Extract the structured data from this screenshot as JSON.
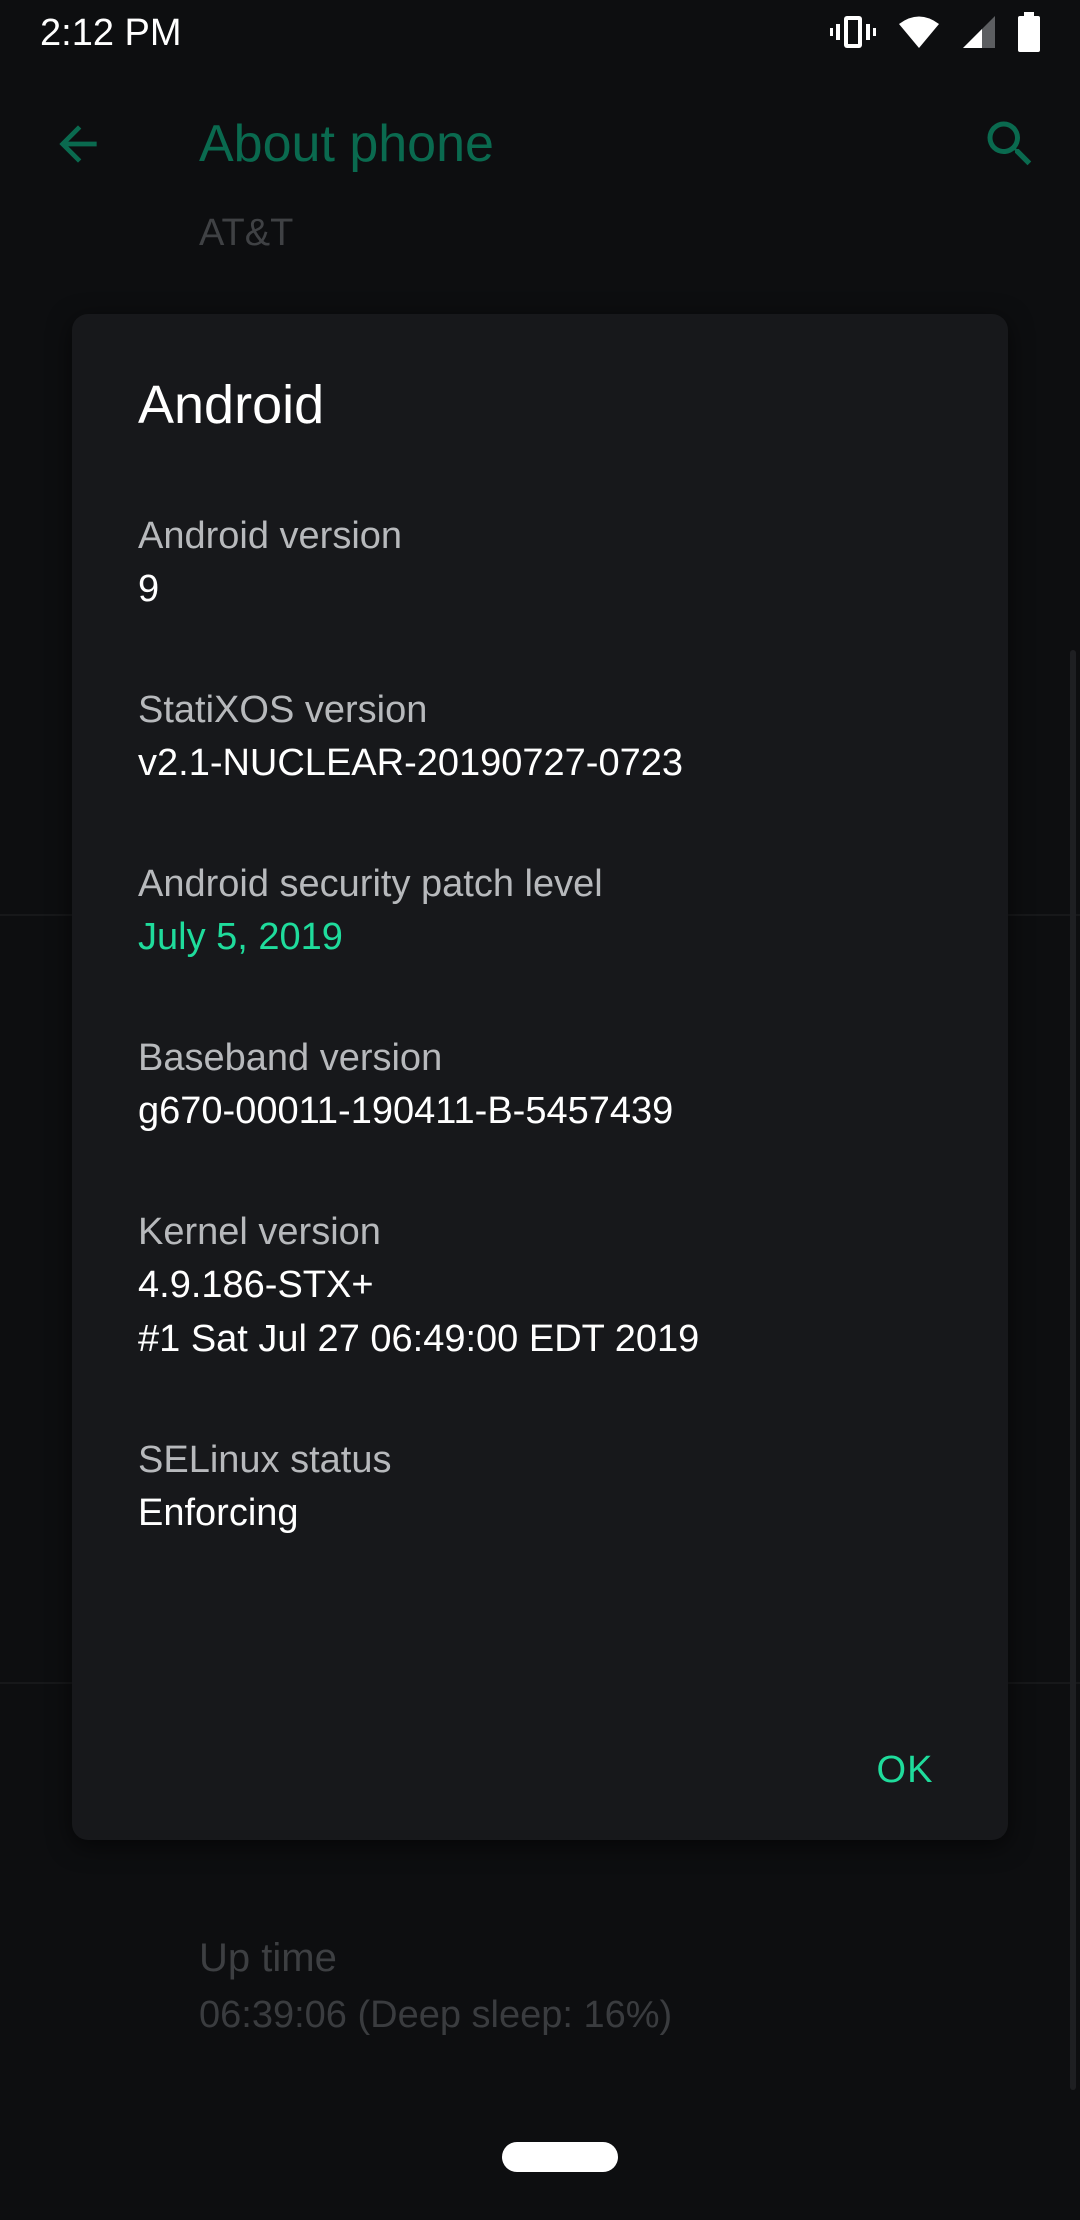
{
  "status_bar": {
    "time": "2:12 PM",
    "icons": [
      "vibrate-icon",
      "wifi-icon",
      "cell-signal-icon",
      "battery-icon"
    ]
  },
  "header": {
    "title": "About phone",
    "carrier": "AT&T",
    "icons": [
      "back-arrow-icon",
      "search-icon"
    ]
  },
  "background_list": {
    "uptime_title": "Up time",
    "uptime_value": "06:39:06 (Deep sleep: 16%)"
  },
  "dialog": {
    "title": "Android",
    "items": [
      {
        "label": "Android version",
        "value": "9"
      },
      {
        "label": "StatiXOS version",
        "value": "v2.1-NUCLEAR-20190727-0723"
      },
      {
        "label": "Android security patch level",
        "value": "July 5, 2019"
      },
      {
        "label": "Baseband version",
        "value": "g670-00011-190411-B-5457439"
      },
      {
        "label": "Kernel version",
        "value_line1": "4.9.186-STX+",
        "value_line2": "#1 Sat Jul 27 06:49:00 EDT 2019"
      },
      {
        "label": "SELinux status",
        "value": "Enforcing"
      }
    ],
    "ok_label": "OK"
  },
  "colors": {
    "accent": "#1fdc9c",
    "title_dim": "#0a6a4f",
    "background": "#0d0e10",
    "dialog_bg": "#17181b"
  }
}
